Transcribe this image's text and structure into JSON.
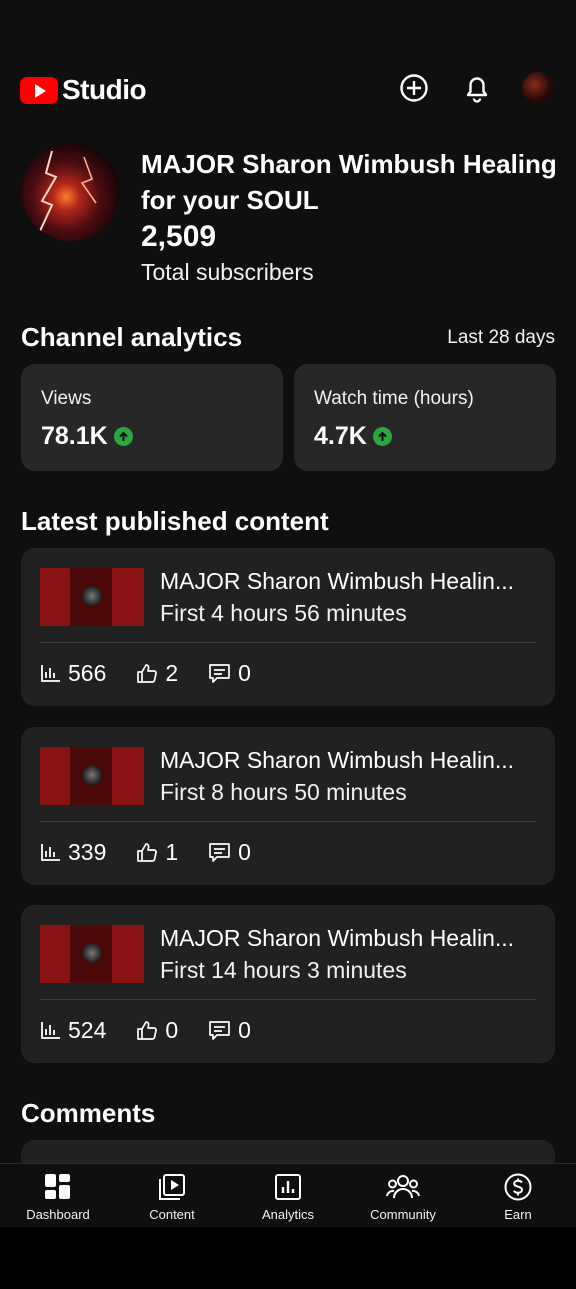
{
  "app": {
    "name": "Studio"
  },
  "channel": {
    "name": "MAJOR Sharon Wimbush Healing for your SOUL",
    "subscribers": "2,509",
    "subscribers_label": "Total subscribers"
  },
  "analytics": {
    "title": "Channel analytics",
    "range": "Last 28 days",
    "cards": [
      {
        "label": "Views",
        "value": "78.1K",
        "trend": "up"
      },
      {
        "label": "Watch time (hours)",
        "value": "4.7K",
        "trend": "up"
      }
    ]
  },
  "latest": {
    "title": "Latest published content",
    "items": [
      {
        "title": "MAJOR Sharon Wimbush Healin...",
        "subtitle": "First 4 hours 56 minutes",
        "views": "566",
        "likes": "2",
        "comments": "0"
      },
      {
        "title": "MAJOR Sharon Wimbush Healin...",
        "subtitle": "First 8 hours 50 minutes",
        "views": "339",
        "likes": "1",
        "comments": "0"
      },
      {
        "title": "MAJOR Sharon Wimbush Healin...",
        "subtitle": "First 14 hours 3 minutes",
        "views": "524",
        "likes": "0",
        "comments": "0"
      }
    ]
  },
  "comments": {
    "title": "Comments"
  },
  "nav": [
    {
      "label": "Dashboard",
      "icon": "dashboard-icon"
    },
    {
      "label": "Content",
      "icon": "content-icon"
    },
    {
      "label": "Analytics",
      "icon": "analytics-icon"
    },
    {
      "label": "Community",
      "icon": "community-icon"
    },
    {
      "label": "Earn",
      "icon": "earn-icon"
    }
  ],
  "colors": {
    "background": "#0f0f0f",
    "card": "#272727",
    "accent_red": "#ff0000",
    "trend_up": "#2ba640"
  }
}
